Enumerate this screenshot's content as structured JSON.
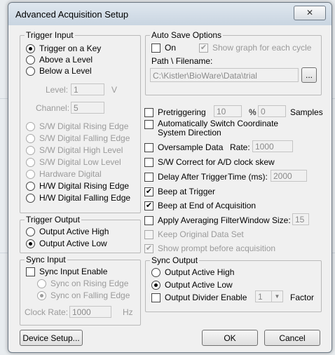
{
  "window": {
    "title": "Advanced Acquisition Setup",
    "close_glyph": "✕"
  },
  "trigger_input": {
    "label": "Trigger Input",
    "options": [
      "Trigger on a Key",
      "Above a Level",
      "Below a Level"
    ],
    "level_label": "Level:",
    "level_value": "1",
    "level_unit": "V",
    "channel_label": "Channel:",
    "channel_value": "5",
    "digital_options": [
      "S/W Digital Rising Edge",
      "S/W Digital Falling Edge",
      "S/W Digital High Level",
      "S/W Digital Low Level",
      "Hardware Digital",
      "H/W Digital Rising Edge",
      "H/W Digital Falling Edge"
    ]
  },
  "trigger_output": {
    "label": "Trigger Output",
    "options": [
      "Output Active High",
      "Output Active Low"
    ]
  },
  "sync_input": {
    "label": "Sync Input",
    "enable_label": "Sync Input Enable",
    "options": [
      "Sync on Rising Edge",
      "Sync on Falling Edge"
    ],
    "clock_label": "Clock Rate:",
    "clock_value": "1000",
    "clock_unit": "Hz"
  },
  "auto_save": {
    "label": "Auto Save Options",
    "on_label": "On",
    "show_graph_label": "Show graph for each cycle",
    "path_label": "Path \\ Filename:",
    "path_value": "C:\\Kistler\\BioWare\\Data\\trial",
    "browse_label": "..."
  },
  "options": {
    "pretriggering_label": "Pretriggering",
    "pretrig_value": "10",
    "percent": "%",
    "samples_value": "0",
    "samples_label": "Samples",
    "auto_switch_label": "Automatically Switch Coordinate System Direction",
    "oversample_label": "Oversample Data",
    "rate_label": "Rate:",
    "rate_value": "1000",
    "sw_correct_label": "S/W Correct for A/D clock skew",
    "delay_label": "Delay After Trigger",
    "time_label": "Time (ms):",
    "time_value": "2000",
    "beep_trigger_label": "Beep at Trigger",
    "beep_end_label": "Beep at End of Acquisition",
    "averaging_label": "Apply Averaging Filter",
    "window_size_label": "Window Size:",
    "window_size_value": "15",
    "keep_original_label": "Keep Original Data Set",
    "show_prompt_label": "Show prompt before acquisition"
  },
  "sync_output": {
    "label": "Sync Output",
    "options": [
      "Output Active High",
      "Output Active Low"
    ],
    "divider_label": "Output Divider Enable",
    "divider_value": "1",
    "factor_label": "Factor"
  },
  "buttons": {
    "device_setup": "Device Setup...",
    "ok": "OK",
    "cancel": "Cancel"
  },
  "check_glyph": "✔"
}
